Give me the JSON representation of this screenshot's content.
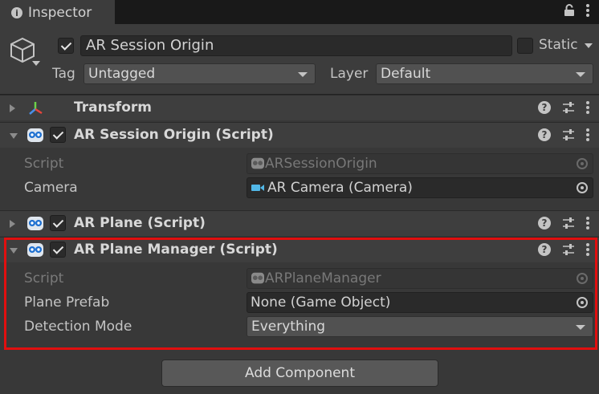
{
  "tab": {
    "label": "Inspector"
  },
  "header": {
    "object_name": "AR Session Origin",
    "static_label": "Static",
    "tag_label": "Tag",
    "tag_value": "Untagged",
    "layer_label": "Layer",
    "layer_value": "Default"
  },
  "components": {
    "transform": {
      "title": "Transform"
    },
    "session_origin": {
      "title": "AR Session Origin (Script)",
      "script_label": "Script",
      "script_value": "ARSessionOrigin",
      "camera_label": "Camera",
      "camera_value": "AR Camera (Camera)"
    },
    "plane": {
      "title": "AR Plane (Script)"
    },
    "plane_manager": {
      "title": "AR Plane Manager (Script)",
      "script_label": "Script",
      "script_value": "ARPlaneManager",
      "prefab_label": "Plane Prefab",
      "prefab_value": "None (Game Object)",
      "detection_label": "Detection Mode",
      "detection_value": "Everything"
    }
  },
  "add_component_label": "Add Component",
  "icons": [
    "info-icon",
    "lock-icon",
    "menu-kebab-icon",
    "gameobject-cube-icon",
    "transform-axis-icon",
    "script-robot-icon",
    "camera-icon",
    "help-icon",
    "presets-icon",
    "object-picker-icon"
  ],
  "colors": {
    "highlight": "#e10f0f",
    "background": "#383838"
  }
}
